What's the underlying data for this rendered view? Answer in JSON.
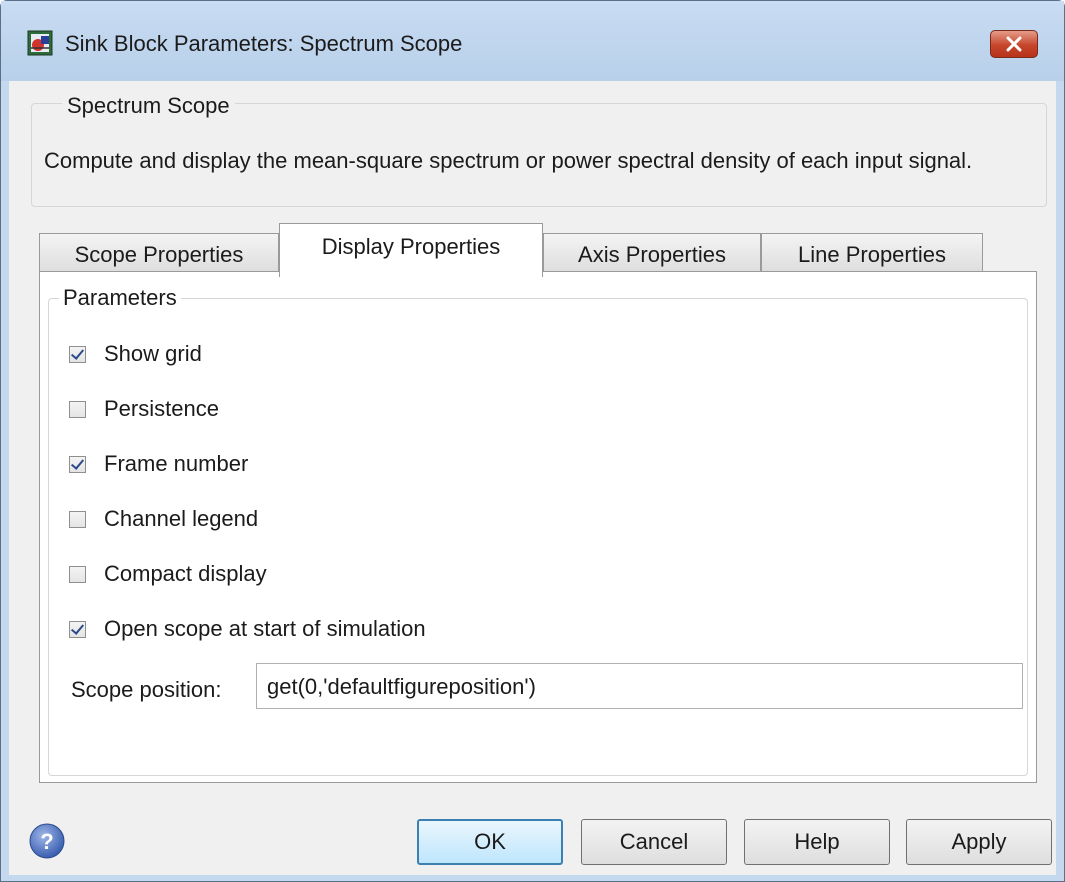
{
  "window": {
    "title": "Sink Block Parameters: Spectrum Scope"
  },
  "description": {
    "group_title": "Spectrum Scope",
    "text": "Compute and display the mean-square spectrum or power spectral density of each input signal."
  },
  "tabs": [
    {
      "label": "Scope Properties"
    },
    {
      "label": "Display Properties"
    },
    {
      "label": "Axis Properties"
    },
    {
      "label": "Line Properties"
    }
  ],
  "active_tab": "Display Properties",
  "parameters": {
    "group_title": "Parameters",
    "checkboxes": [
      {
        "label": "Show grid",
        "checked": true
      },
      {
        "label": "Persistence",
        "checked": false
      },
      {
        "label": "Frame number",
        "checked": true
      },
      {
        "label": "Channel legend",
        "checked": false
      },
      {
        "label": "Compact display",
        "checked": false
      },
      {
        "label": "Open scope at start of simulation",
        "checked": true
      }
    ],
    "scope_position": {
      "label": "Scope position:",
      "value": "get(0,'defaultfigureposition')"
    }
  },
  "buttons": {
    "ok": "OK",
    "cancel": "Cancel",
    "help": "Help",
    "apply": "Apply"
  },
  "icons": {
    "app": "simulink-block-icon",
    "close": "close-icon",
    "help": "help-icon"
  },
  "colors": {
    "frame": "#c4d8ee",
    "client": "#f0f0f0",
    "close_button": "#c6462b",
    "default_button_border": "#3c7fb1"
  }
}
